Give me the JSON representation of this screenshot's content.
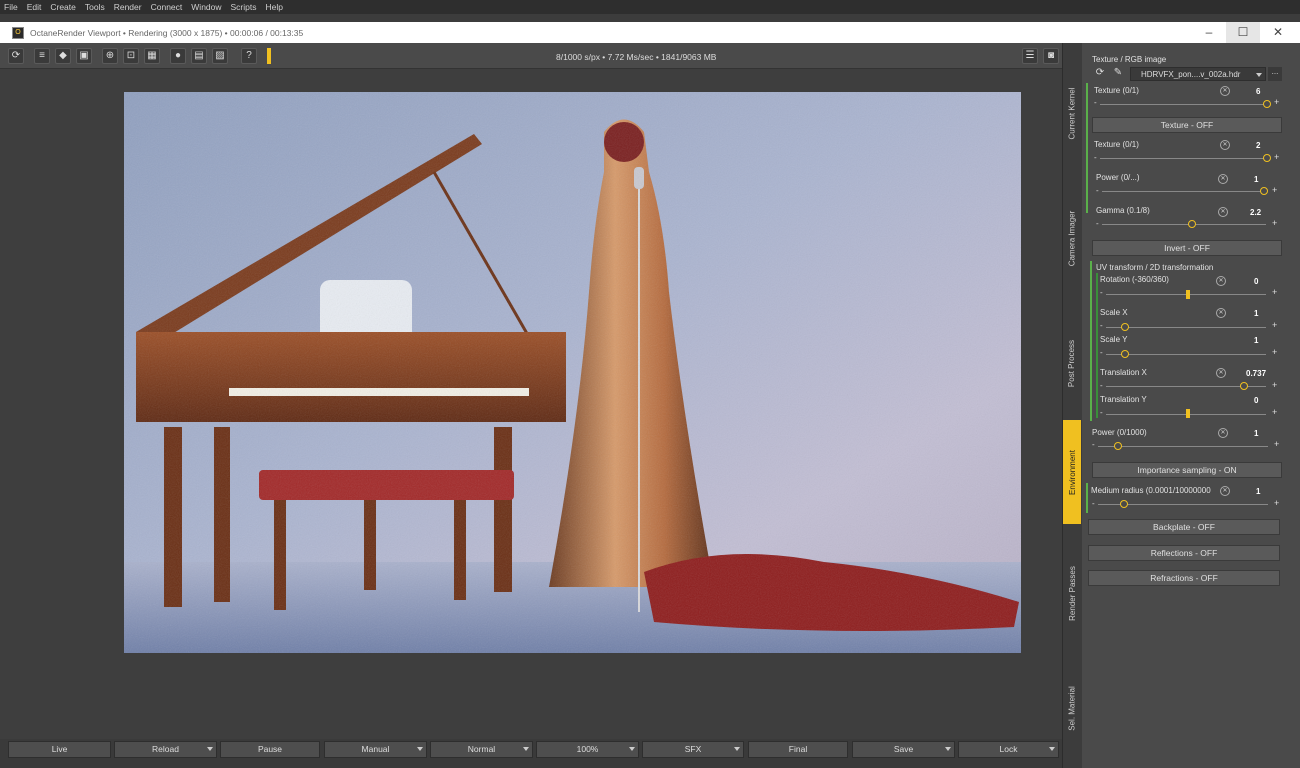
{
  "menu": [
    "File",
    "Edit",
    "Create",
    "Tools",
    "Render",
    "Connect",
    "Window",
    "Scripts",
    "Help"
  ],
  "window": {
    "title": "OctaneRender Viewport • Rendering (3000 x 1875) • 00:00:06 / 00:13:35"
  },
  "toolbar": {
    "stats": "8/1000 s/px • 7.72 Ms/sec • 1841/9063 MB",
    "help": "?"
  },
  "bottom_buttons": [
    "Live",
    "Reload",
    "Pause",
    "Manual",
    "Normal",
    "100%",
    "SFX",
    "Final",
    "Save",
    "Lock"
  ],
  "vertical_tabs": [
    "Current Kernel",
    "Camera Imager",
    "Post Process",
    "Environment",
    "Render Passes",
    "Sel. Material"
  ],
  "panel": {
    "header": "Texture / RGB image",
    "file": "HDRVFX_pon....v_002a.hdr",
    "more": "...",
    "texture1": {
      "label": "Texture (0/1)",
      "value": "6"
    },
    "texture_off": "Texture - OFF",
    "texture2": {
      "label": "Texture (0/1)",
      "value": "2"
    },
    "power1": {
      "label": "Power (0/...)",
      "value": "1"
    },
    "gamma": {
      "label": "Gamma (0.1/8)",
      "value": "2.2"
    },
    "invert": "Invert - OFF",
    "uv_header": "UV transform / 2D transformation",
    "rotation": {
      "label": "Rotation (-360/360)",
      "value": "0"
    },
    "scale_x": {
      "label": "Scale X",
      "value": "1"
    },
    "scale_y": {
      "label": "Scale Y",
      "value": "1"
    },
    "translation_x": {
      "label": "Translation X",
      "value": "0.737"
    },
    "translation_y": {
      "label": "Translation Y",
      "value": "0"
    },
    "power2": {
      "label": "Power (0/1000)",
      "value": "1"
    },
    "importance": "Importance sampling - ON",
    "medium": {
      "label": "Medium radius (0.0001/10000000",
      "value": "1"
    },
    "backplate": "Backplate - OFF",
    "reflections": "Reflections - OFF",
    "refractions": "Refractions - OFF"
  }
}
